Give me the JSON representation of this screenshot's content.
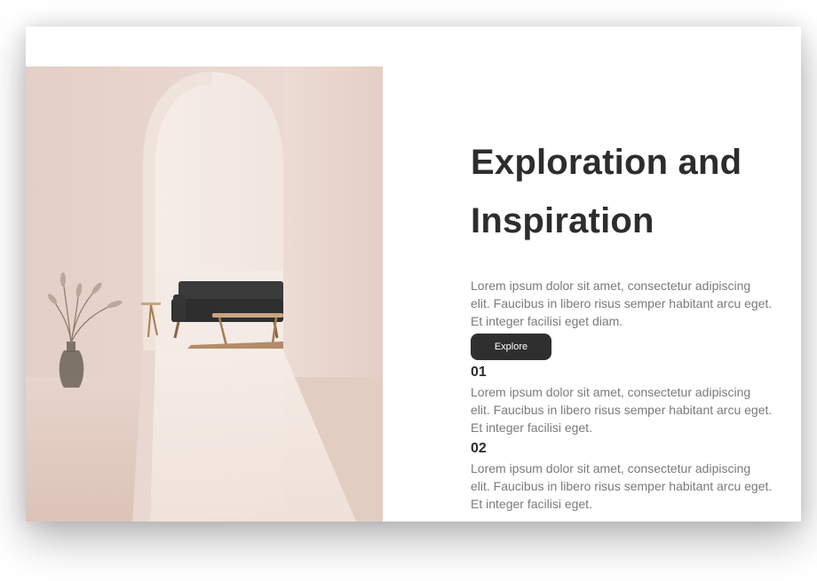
{
  "hero": {
    "title": "Exploration and Inspiration",
    "description": "Lorem ipsum dolor sit amet, consectetur adipiscing elit. Faucibus in libero risus semper habitant arcu eget. Et integer facilisi eget diam.",
    "button_label": "Explore"
  },
  "features": [
    {
      "number": "01",
      "text": "Lorem ipsum dolor sit amet, consectetur adipiscing elit. Faucibus in libero risus semper habitant arcu eget. Et integer facilisi eget."
    },
    {
      "number": "02",
      "text": "Lorem ipsum dolor sit amet, consectetur adipiscing elit. Faucibus in libero risus semper habitant arcu eget. Et integer facilisi eget."
    }
  ],
  "colors": {
    "button_bg": "#2f2f2f",
    "heading": "#2d2d2d",
    "body_text": "#7a7a7a",
    "photo_wall": "#e6d3c9"
  }
}
